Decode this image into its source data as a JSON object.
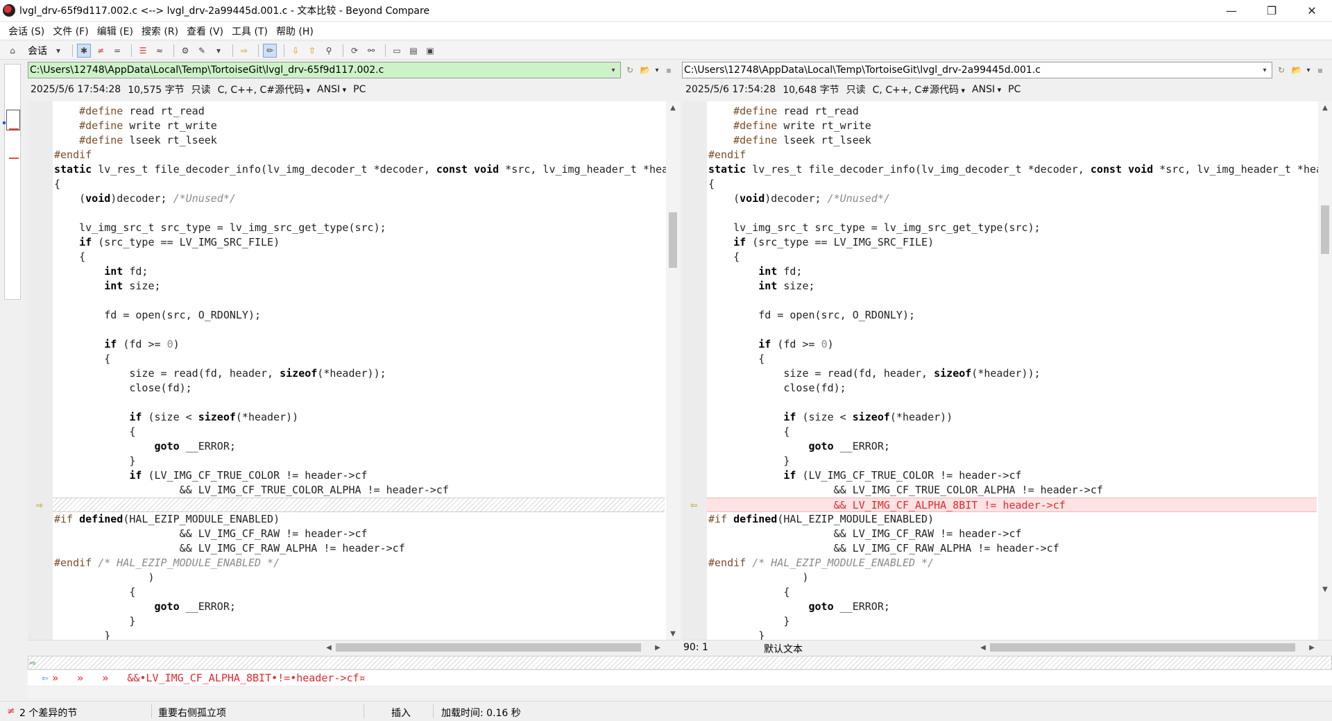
{
  "window": {
    "title": "lvgl_drv-65f9d117.002.c <--> lvgl_drv-2a99445d.001.c - 文本比较 - Beyond Compare",
    "minimize": "—",
    "maximize": "❐",
    "close": "✕"
  },
  "menu": [
    "会话 (S)",
    "文件 (F)",
    "编辑 (E)",
    "搜索 (R)",
    "查看 (V)",
    "工具 (T)",
    "帮助 (H)"
  ],
  "toolbar": {
    "session_label": "会话"
  },
  "left": {
    "path": "C:\\Users\\12748\\AppData\\Local\\Temp\\TortoiseGit\\lvgl_drv-65f9d117.002.c",
    "date": "2025/5/6 17:54:28",
    "size": "10,575 字节",
    "readonly": "只读",
    "format": "C, C++, C#源代码",
    "encoding": "ANSI",
    "lineend": "PC"
  },
  "right": {
    "path": "C:\\Users\\12748\\AppData\\Local\\Temp\\TortoiseGit\\lvgl_drv-2a99445d.001.c",
    "date": "2025/5/6 17:54:28",
    "size": "10,648 字节",
    "readonly": "只读",
    "format": "C, C++, C#源代码",
    "encoding": "ANSI",
    "lineend": "PC"
  },
  "code_left": [
    "    #define read rt_read",
    "    #define write rt_write",
    "    #define lseek rt_lseek",
    "#endif",
    "static lv_res_t file_decoder_info(lv_img_decoder_t *decoder, const void *src, lv_img_header_t *hea",
    "{",
    "    (void)decoder; /*Unused*/",
    "",
    "    lv_img_src_t src_type = lv_img_src_get_type(src);",
    "    if (src_type == LV_IMG_SRC_FILE)",
    "    {",
    "        int fd;",
    "        int size;",
    "",
    "        fd = open(src, O_RDONLY);",
    "",
    "        if (fd >= 0)",
    "        {",
    "            size = read(fd, header, sizeof(*header));",
    "            close(fd);",
    "",
    "            if (size < sizeof(*header))",
    "            {",
    "                goto __ERROR;",
    "            }",
    "            if (LV_IMG_CF_TRUE_COLOR != header->cf",
    "                    && LV_IMG_CF_TRUE_COLOR_ALPHA != header->cf",
    "",
    "#if defined(HAL_EZIP_MODULE_ENABLED)",
    "                    && LV_IMG_CF_RAW != header->cf",
    "                    && LV_IMG_CF_RAW_ALPHA != header->cf",
    "#endif /* HAL_EZIP_MODULE_ENABLED */",
    "               )",
    "            {",
    "                goto __ERROR;",
    "            }",
    "        }"
  ],
  "code_right": [
    "    #define read rt_read",
    "    #define write rt_write",
    "    #define lseek rt_lseek",
    "#endif",
    "static lv_res_t file_decoder_info(lv_img_decoder_t *decoder, const void *src, lv_img_header_t *hea",
    "{",
    "    (void)decoder; /*Unused*/",
    "",
    "    lv_img_src_t src_type = lv_img_src_get_type(src);",
    "    if (src_type == LV_IMG_SRC_FILE)",
    "    {",
    "        int fd;",
    "        int size;",
    "",
    "        fd = open(src, O_RDONLY);",
    "",
    "        if (fd >= 0)",
    "        {",
    "            size = read(fd, header, sizeof(*header));",
    "            close(fd);",
    "",
    "            if (size < sizeof(*header))",
    "            {",
    "                goto __ERROR;",
    "            }",
    "            if (LV_IMG_CF_TRUE_COLOR != header->cf",
    "                    && LV_IMG_CF_TRUE_COLOR_ALPHA != header->cf",
    "                    && LV_IMG_CF_ALPHA_8BIT != header->cf",
    "#if defined(HAL_EZIP_MODULE_ENABLED)",
    "                    && LV_IMG_CF_RAW != header->cf",
    "                    && LV_IMG_CF_RAW_ALPHA != header->cf",
    "#endif /* HAL_EZIP_MODULE_ENABLED */",
    "               )",
    "            {",
    "                goto __ERROR;",
    "            }",
    "        }"
  ],
  "diff_line_index": 27,
  "right_status": {
    "position": "90: 1",
    "text_type": "默认文本"
  },
  "compare_line": "»   »   »   &&•LV_IMG_CF_ALPHA_8BIT•!=•header->cf¤",
  "status": {
    "diff_sections": "2 个差异的节",
    "important": "重要右侧孤立项",
    "insert_mode": "插入",
    "load_time": "加载时间: 0.16 秒"
  },
  "colors": {
    "left_path_bg": "#cdf2c8",
    "diff_text": "#e4282e",
    "diff_bg": "#fde3e3"
  }
}
